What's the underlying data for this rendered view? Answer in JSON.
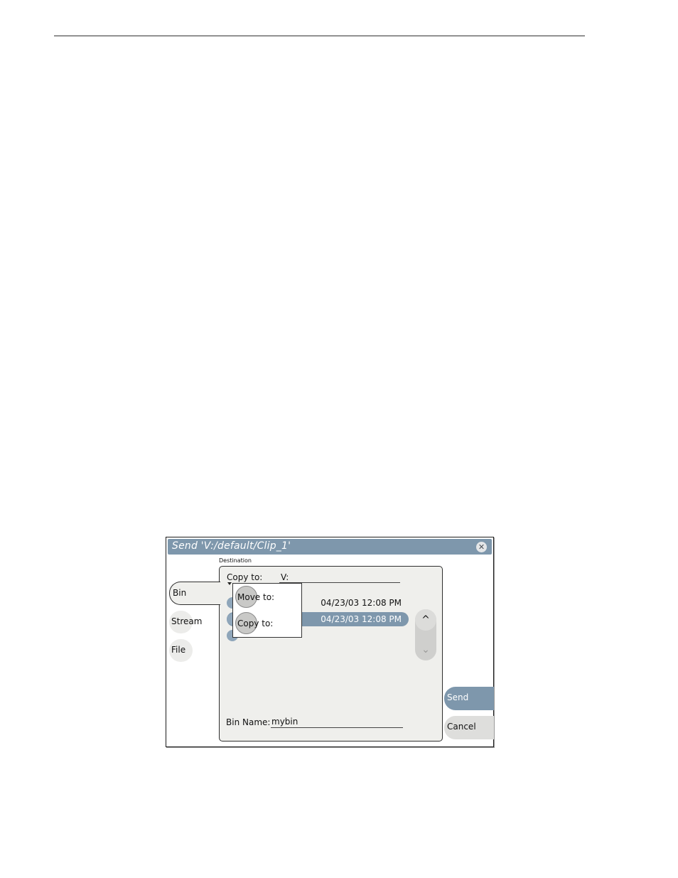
{
  "dialog": {
    "title": "Send 'V:/default/Clip_1'",
    "close_icon": "close-icon",
    "destination_label": "Destination"
  },
  "tabs": [
    {
      "label": "Bin",
      "selected": true
    },
    {
      "label": "Stream",
      "selected": false
    },
    {
      "label": "File",
      "selected": false
    }
  ],
  "destination": {
    "mode_label": "Copy to:",
    "path": "V:",
    "mode_options": [
      "Move to:",
      "Copy to:"
    ],
    "bins": [
      {
        "date": "04/23/03 12:08 PM",
        "selected": false
      },
      {
        "date": "04/23/03 12:08 PM",
        "selected": true
      }
    ],
    "bin_name_label": "Bin Name:",
    "bin_name_value": "mybin"
  },
  "scroll": {
    "up_icon": "chevron-up-icon",
    "down_icon": "chevron-down-icon"
  },
  "actions": {
    "send": "Send",
    "cancel": "Cancel"
  },
  "colors": {
    "titlebar": "#7e97ac",
    "selected_row": "#7e97ac",
    "panel": "#efefec"
  }
}
